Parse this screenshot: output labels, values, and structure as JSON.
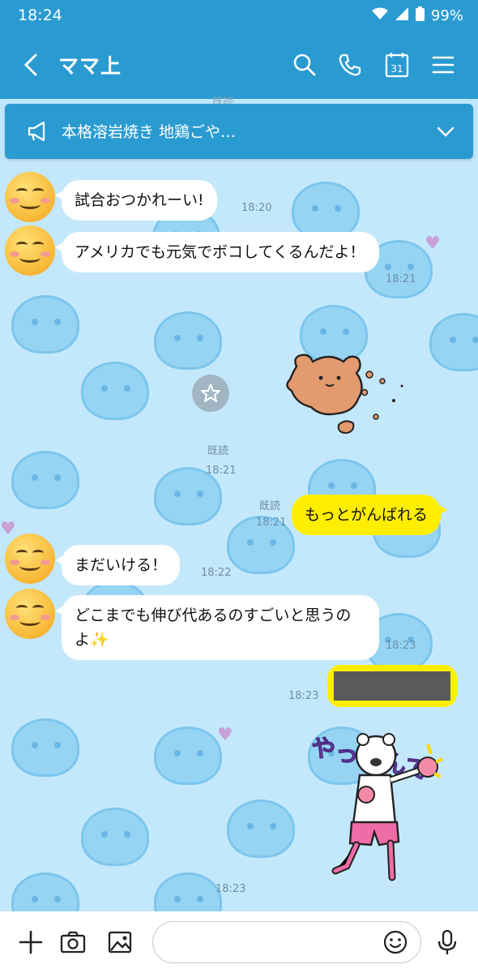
{
  "status_bar": {
    "time": "18:24",
    "battery": "99%",
    "icons": [
      "wifi-icon",
      "signal-icon",
      "battery-icon"
    ]
  },
  "header": {
    "title": "ママ上",
    "icons": [
      "back-icon",
      "search-icon",
      "phone-icon",
      "calendar-icon",
      "menu-icon"
    ],
    "calendar_day": "31"
  },
  "announcement": {
    "text": "本格溶岩焼き 地鶏ごや…"
  },
  "behind_announcement": {
    "read_label": "既読"
  },
  "messages": [
    {
      "side": "left",
      "text": "試合おつかれーい!",
      "time": "18:20"
    },
    {
      "side": "left",
      "text": "アメリカでも元気でボコしてくるんだよ！",
      "time": "18:21"
    },
    {
      "side": "right",
      "type": "sticker",
      "read": "既読",
      "time": "18:21",
      "desc": "bear-sticker"
    },
    {
      "side": "right",
      "text": "もっとがんばれる",
      "read": "既読",
      "time": "18:21"
    },
    {
      "side": "left",
      "text": "まだいける！",
      "time": "18:22"
    },
    {
      "side": "left",
      "text": "どこまでも伸び代あるのすごいと思うのよ✨",
      "time": "18:23"
    },
    {
      "side": "right",
      "type": "redacted",
      "time": "18:23"
    },
    {
      "side": "right",
      "type": "sticker",
      "sticker_text": "やったんで",
      "time": "18:23",
      "desc": "boxing-bear-sticker"
    }
  ],
  "colors": {
    "header": "#2a9bd1",
    "bubble_me": "#ffee00",
    "bubble_other": "#ffffff",
    "background": "#c4e8fb"
  },
  "input": {
    "placeholder": ""
  }
}
